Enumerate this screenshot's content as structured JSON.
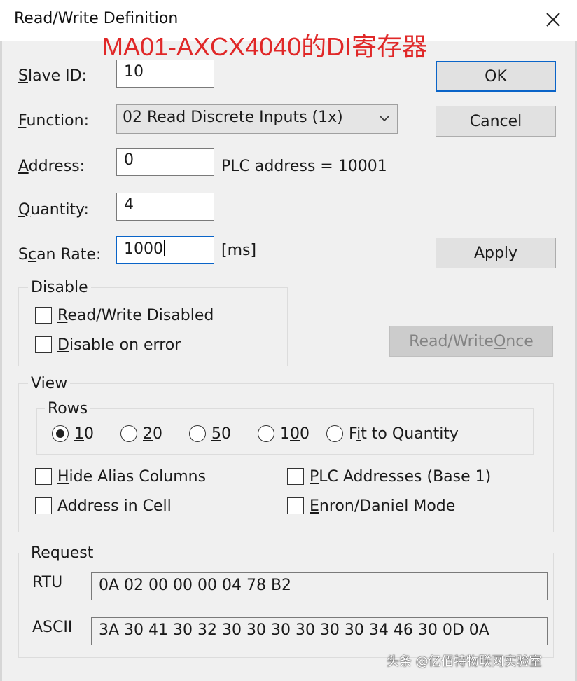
{
  "window": {
    "title": "Read/Write Definition",
    "overlay_caption": "MA01-AXCX4040的DI寄存器"
  },
  "form": {
    "slave_id": {
      "label_accel": "S",
      "label_rest": "lave ID:",
      "value": "10"
    },
    "function": {
      "label_accel": "F",
      "label_rest": "unction:",
      "selected": "02 Read Discrete Inputs (1x)"
    },
    "address": {
      "label_accel": "A",
      "label_rest": "ddress:",
      "value": "0",
      "plc_address_text": "PLC address = 10001"
    },
    "quantity": {
      "label_accel": "Q",
      "label_rest": "uantity:",
      "value": "4"
    },
    "scan_rate": {
      "label_pre": "S",
      "label_accel": "c",
      "label_rest": "an Rate:",
      "value": "1000",
      "unit": "[ms]"
    }
  },
  "buttons": {
    "ok": "OK",
    "cancel": "Cancel",
    "apply": "Apply",
    "rw_once_pre": "Read/Write ",
    "rw_once_accel": "O",
    "rw_once_rest": "nce"
  },
  "disable_group": {
    "legend": "Disable",
    "rw_disabled": {
      "accel": "R",
      "rest": "ead/Write Disabled",
      "checked": false
    },
    "disable_on_error": {
      "accel": "D",
      "rest": "isable on error",
      "checked": false
    }
  },
  "view_group": {
    "legend": "View",
    "rows_legend": "Rows",
    "rows_options": [
      {
        "accel": "1",
        "rest": "0",
        "checked": true
      },
      {
        "accel": "2",
        "rest": "0",
        "checked": false
      },
      {
        "accel": "5",
        "rest": "0",
        "checked": false
      },
      {
        "pre": "1",
        "accel": "0",
        "rest": "0",
        "checked": false
      },
      {
        "pre": "F",
        "accel": "i",
        "rest": "t to Quantity",
        "checked": false
      }
    ],
    "hide_alias": {
      "accel": "H",
      "rest": "ide Alias Columns",
      "checked": false
    },
    "plc_addresses": {
      "accel": "P",
      "rest": "LC Addresses (Base 1)",
      "checked": false
    },
    "address_in_cell": {
      "label": "Address in Cell",
      "checked": false
    },
    "enron_mode": {
      "accel": "E",
      "rest": "nron/Daniel Mode",
      "checked": false
    }
  },
  "request_group": {
    "legend": "Request",
    "rtu_label": "RTU",
    "rtu_value": "0A 02 00 00 00 04 78 B2",
    "ascii_label": "ASCII",
    "ascii_value": "3A 30 41 30 32 30 30 30 30 30 30 34 46 30 0D 0A"
  },
  "watermark": "头条 @亿佰特物联网实验室",
  "colors": {
    "overlay_red": "#e02828",
    "focus_blue": "#0a64c8",
    "dialog_bg": "#f0f0f0"
  }
}
